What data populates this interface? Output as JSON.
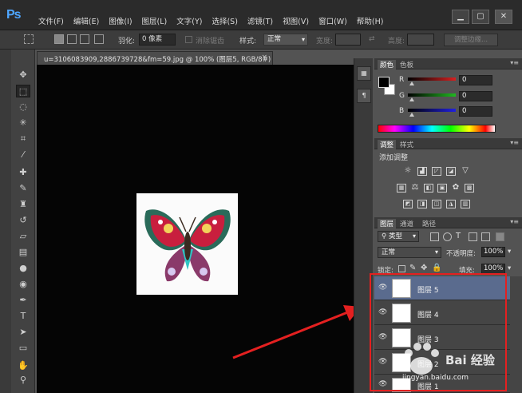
{
  "app": {
    "logo": "Ps"
  },
  "menu": [
    "文件(F)",
    "编辑(E)",
    "图像(I)",
    "图层(L)",
    "文字(Y)",
    "选择(S)",
    "滤镜(T)",
    "视图(V)",
    "窗口(W)",
    "帮助(H)"
  ],
  "window_controls": {
    "minimize": "▁",
    "maximize": "▢",
    "close": "✕"
  },
  "options": {
    "feather_label": "羽化:",
    "feather_value": "0 像素",
    "antialias_label": "消除锯齿",
    "style_label": "样式:",
    "style_value": "正常",
    "width_label": "宽度:",
    "height_label": "高度:",
    "refine_edge": "调整边缘..."
  },
  "document": {
    "tab_title": "u=3106083909,2886739728&fm=59.jpg @ 100% (图层5, RGB/8#) *",
    "close": "×",
    "artwork_icon": "butterfly-artwork"
  },
  "color_panel": {
    "tabs": [
      "颜色",
      "色板"
    ],
    "foreground": "#000000",
    "background": "#ffffff",
    "channels": [
      {
        "label": "R",
        "value": "0",
        "color": "#d82020"
      },
      {
        "label": "G",
        "value": "0",
        "color": "#20b820"
      },
      {
        "label": "B",
        "value": "0",
        "color": "#2020e0"
      }
    ]
  },
  "adjustments_panel": {
    "tabs": [
      "调整",
      "样式"
    ],
    "title": "添加调整"
  },
  "layers_panel": {
    "tabs": [
      "图层",
      "通道",
      "路径"
    ],
    "filter_kind": "类型",
    "blend_mode": "正常",
    "opacity_label": "不透明度:",
    "opacity_value": "100%",
    "lock_label": "锁定:",
    "fill_label": "填充:",
    "fill_value": "100%",
    "layers": [
      {
        "name": "图层 5",
        "selected": true
      },
      {
        "name": "图层 4",
        "selected": false
      },
      {
        "name": "图层 3",
        "selected": false
      },
      {
        "name": "图层 2",
        "selected": false
      },
      {
        "name": "图层 1",
        "selected": false
      }
    ]
  },
  "annotation": {
    "color": "#e42020"
  },
  "watermark": {
    "brand": "Bai 经验",
    "url": "jingyan.baidu.com"
  }
}
